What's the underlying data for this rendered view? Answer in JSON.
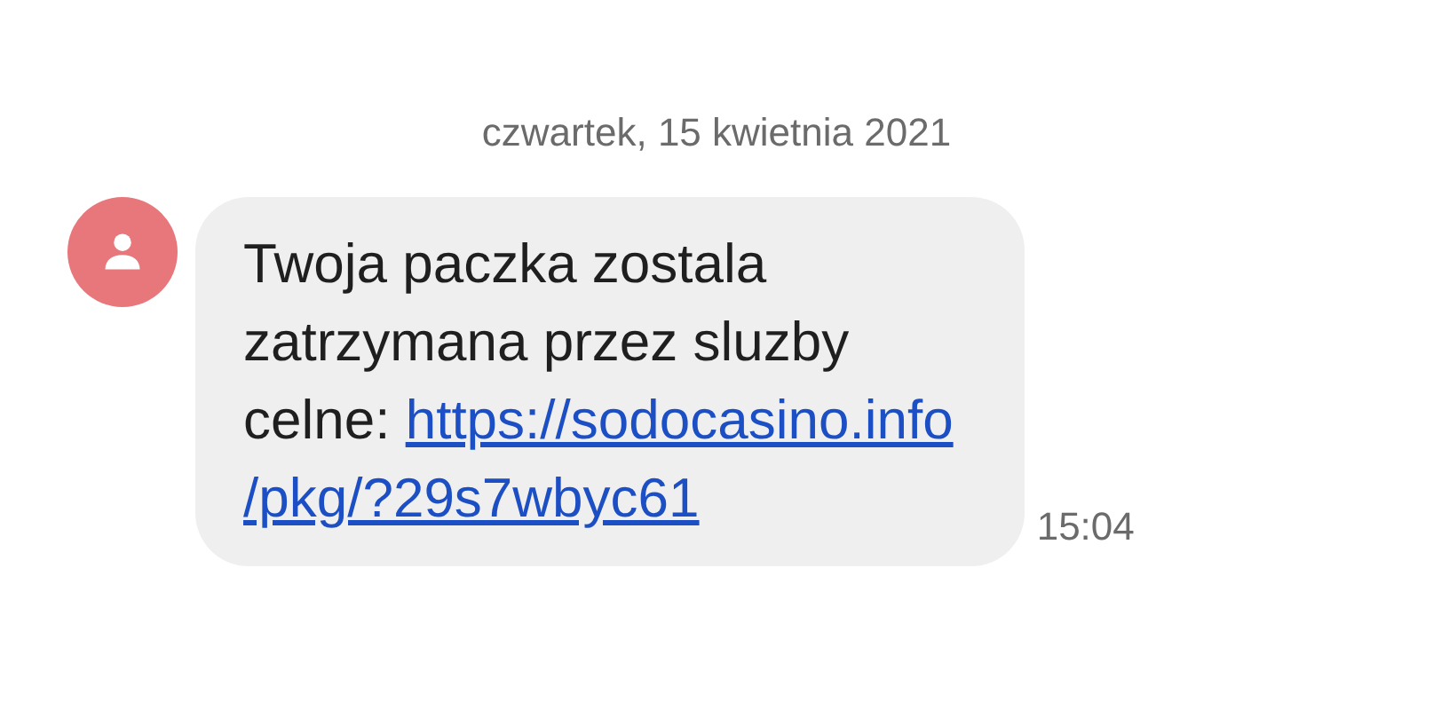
{
  "date_header": "czwartek, 15 kwietnia 2021",
  "message": {
    "text_lines": [
      "Twoja paczka zostala",
      "zatrzymana przez sluzby",
      "celne: "
    ],
    "link_lines": [
      "https://sodocasino.info",
      "/pkg/?29s7wbyc61"
    ],
    "time": "15:04"
  }
}
